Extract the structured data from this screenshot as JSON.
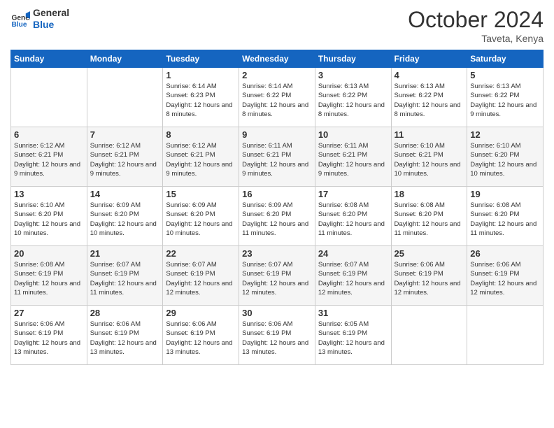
{
  "header": {
    "logo_line1": "General",
    "logo_line2": "Blue",
    "month": "October 2024",
    "location": "Taveta, Kenya"
  },
  "weekdays": [
    "Sunday",
    "Monday",
    "Tuesday",
    "Wednesday",
    "Thursday",
    "Friday",
    "Saturday"
  ],
  "weeks": [
    [
      {
        "day": "",
        "sunrise": "",
        "sunset": "",
        "daylight": ""
      },
      {
        "day": "",
        "sunrise": "",
        "sunset": "",
        "daylight": ""
      },
      {
        "day": "1",
        "sunrise": "Sunrise: 6:14 AM",
        "sunset": "Sunset: 6:23 PM",
        "daylight": "Daylight: 12 hours and 8 minutes."
      },
      {
        "day": "2",
        "sunrise": "Sunrise: 6:14 AM",
        "sunset": "Sunset: 6:22 PM",
        "daylight": "Daylight: 12 hours and 8 minutes."
      },
      {
        "day": "3",
        "sunrise": "Sunrise: 6:13 AM",
        "sunset": "Sunset: 6:22 PM",
        "daylight": "Daylight: 12 hours and 8 minutes."
      },
      {
        "day": "4",
        "sunrise": "Sunrise: 6:13 AM",
        "sunset": "Sunset: 6:22 PM",
        "daylight": "Daylight: 12 hours and 8 minutes."
      },
      {
        "day": "5",
        "sunrise": "Sunrise: 6:13 AM",
        "sunset": "Sunset: 6:22 PM",
        "daylight": "Daylight: 12 hours and 9 minutes."
      }
    ],
    [
      {
        "day": "6",
        "sunrise": "Sunrise: 6:12 AM",
        "sunset": "Sunset: 6:21 PM",
        "daylight": "Daylight: 12 hours and 9 minutes."
      },
      {
        "day": "7",
        "sunrise": "Sunrise: 6:12 AM",
        "sunset": "Sunset: 6:21 PM",
        "daylight": "Daylight: 12 hours and 9 minutes."
      },
      {
        "day": "8",
        "sunrise": "Sunrise: 6:12 AM",
        "sunset": "Sunset: 6:21 PM",
        "daylight": "Daylight: 12 hours and 9 minutes."
      },
      {
        "day": "9",
        "sunrise": "Sunrise: 6:11 AM",
        "sunset": "Sunset: 6:21 PM",
        "daylight": "Daylight: 12 hours and 9 minutes."
      },
      {
        "day": "10",
        "sunrise": "Sunrise: 6:11 AM",
        "sunset": "Sunset: 6:21 PM",
        "daylight": "Daylight: 12 hours and 9 minutes."
      },
      {
        "day": "11",
        "sunrise": "Sunrise: 6:10 AM",
        "sunset": "Sunset: 6:21 PM",
        "daylight": "Daylight: 12 hours and 10 minutes."
      },
      {
        "day": "12",
        "sunrise": "Sunrise: 6:10 AM",
        "sunset": "Sunset: 6:20 PM",
        "daylight": "Daylight: 12 hours and 10 minutes."
      }
    ],
    [
      {
        "day": "13",
        "sunrise": "Sunrise: 6:10 AM",
        "sunset": "Sunset: 6:20 PM",
        "daylight": "Daylight: 12 hours and 10 minutes."
      },
      {
        "day": "14",
        "sunrise": "Sunrise: 6:09 AM",
        "sunset": "Sunset: 6:20 PM",
        "daylight": "Daylight: 12 hours and 10 minutes."
      },
      {
        "day": "15",
        "sunrise": "Sunrise: 6:09 AM",
        "sunset": "Sunset: 6:20 PM",
        "daylight": "Daylight: 12 hours and 10 minutes."
      },
      {
        "day": "16",
        "sunrise": "Sunrise: 6:09 AM",
        "sunset": "Sunset: 6:20 PM",
        "daylight": "Daylight: 12 hours and 11 minutes."
      },
      {
        "day": "17",
        "sunrise": "Sunrise: 6:08 AM",
        "sunset": "Sunset: 6:20 PM",
        "daylight": "Daylight: 12 hours and 11 minutes."
      },
      {
        "day": "18",
        "sunrise": "Sunrise: 6:08 AM",
        "sunset": "Sunset: 6:20 PM",
        "daylight": "Daylight: 12 hours and 11 minutes."
      },
      {
        "day": "19",
        "sunrise": "Sunrise: 6:08 AM",
        "sunset": "Sunset: 6:20 PM",
        "daylight": "Daylight: 12 hours and 11 minutes."
      }
    ],
    [
      {
        "day": "20",
        "sunrise": "Sunrise: 6:08 AM",
        "sunset": "Sunset: 6:19 PM",
        "daylight": "Daylight: 12 hours and 11 minutes."
      },
      {
        "day": "21",
        "sunrise": "Sunrise: 6:07 AM",
        "sunset": "Sunset: 6:19 PM",
        "daylight": "Daylight: 12 hours and 11 minutes."
      },
      {
        "day": "22",
        "sunrise": "Sunrise: 6:07 AM",
        "sunset": "Sunset: 6:19 PM",
        "daylight": "Daylight: 12 hours and 12 minutes."
      },
      {
        "day": "23",
        "sunrise": "Sunrise: 6:07 AM",
        "sunset": "Sunset: 6:19 PM",
        "daylight": "Daylight: 12 hours and 12 minutes."
      },
      {
        "day": "24",
        "sunrise": "Sunrise: 6:07 AM",
        "sunset": "Sunset: 6:19 PM",
        "daylight": "Daylight: 12 hours and 12 minutes."
      },
      {
        "day": "25",
        "sunrise": "Sunrise: 6:06 AM",
        "sunset": "Sunset: 6:19 PM",
        "daylight": "Daylight: 12 hours and 12 minutes."
      },
      {
        "day": "26",
        "sunrise": "Sunrise: 6:06 AM",
        "sunset": "Sunset: 6:19 PM",
        "daylight": "Daylight: 12 hours and 12 minutes."
      }
    ],
    [
      {
        "day": "27",
        "sunrise": "Sunrise: 6:06 AM",
        "sunset": "Sunset: 6:19 PM",
        "daylight": "Daylight: 12 hours and 13 minutes."
      },
      {
        "day": "28",
        "sunrise": "Sunrise: 6:06 AM",
        "sunset": "Sunset: 6:19 PM",
        "daylight": "Daylight: 12 hours and 13 minutes."
      },
      {
        "day": "29",
        "sunrise": "Sunrise: 6:06 AM",
        "sunset": "Sunset: 6:19 PM",
        "daylight": "Daylight: 12 hours and 13 minutes."
      },
      {
        "day": "30",
        "sunrise": "Sunrise: 6:06 AM",
        "sunset": "Sunset: 6:19 PM",
        "daylight": "Daylight: 12 hours and 13 minutes."
      },
      {
        "day": "31",
        "sunrise": "Sunrise: 6:05 AM",
        "sunset": "Sunset: 6:19 PM",
        "daylight": "Daylight: 12 hours and 13 minutes."
      },
      {
        "day": "",
        "sunrise": "",
        "sunset": "",
        "daylight": ""
      },
      {
        "day": "",
        "sunrise": "",
        "sunset": "",
        "daylight": ""
      }
    ]
  ]
}
